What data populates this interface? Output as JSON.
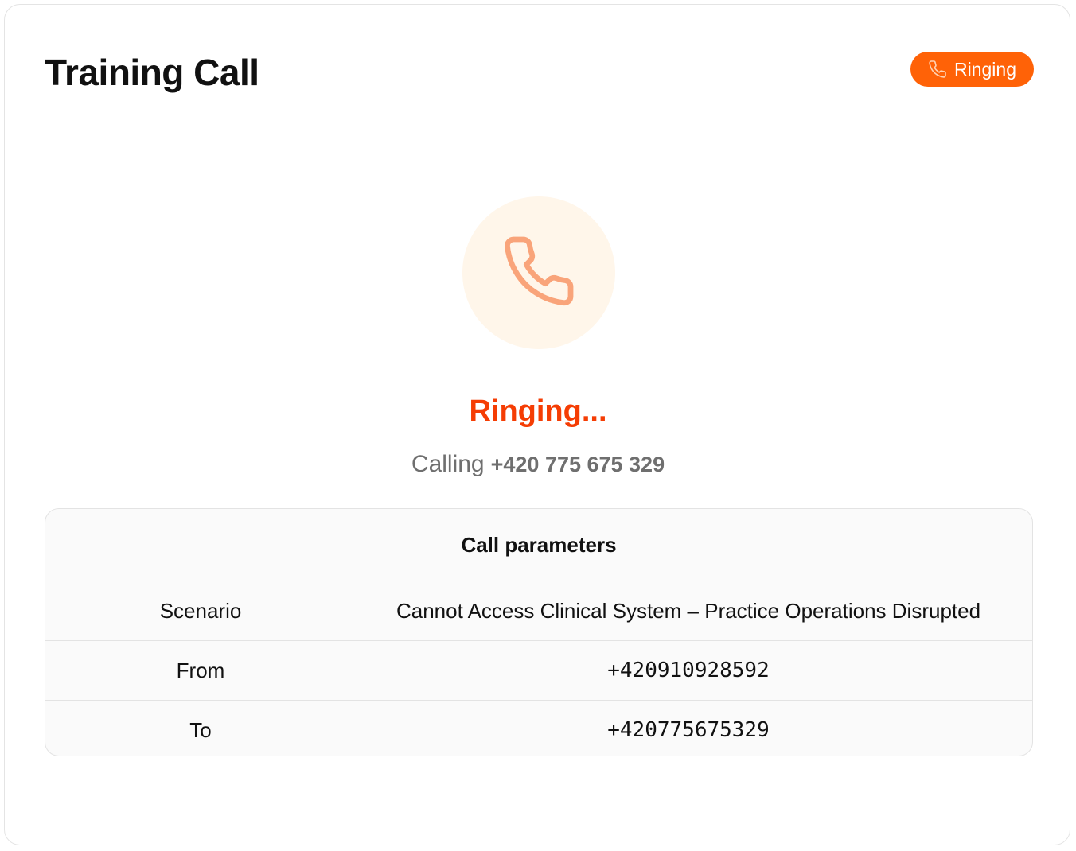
{
  "header": {
    "title": "Training Call",
    "status_label": "Ringing"
  },
  "call": {
    "status_text": "Ringing...",
    "calling_label": "Calling",
    "calling_number": "+420 775 675 329"
  },
  "params": {
    "title": "Call parameters",
    "rows": [
      {
        "label": "Scenario",
        "value": "Cannot Access Clinical System – Practice Operations Disrupted"
      },
      {
        "label": "From",
        "value": "+420910928592"
      },
      {
        "label": "To",
        "value": "+420775675329"
      }
    ]
  },
  "colors": {
    "accent": "#ff6207",
    "status_text": "#f53d04",
    "avatar_bg": "#fff6ea",
    "phone_icon": "#f9a47a"
  },
  "icons": {
    "badge_icon": "phone-icon",
    "avatar_icon": "phone-icon"
  }
}
